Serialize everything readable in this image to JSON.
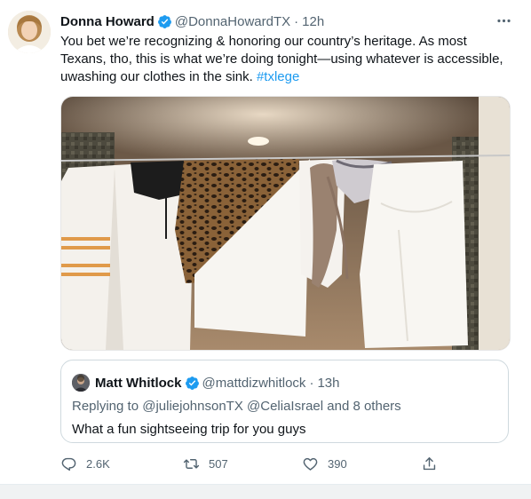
{
  "tweet": {
    "author_name": "Donna Howard",
    "author_handle": "@DonnaHowardTX",
    "separator": "·",
    "time": "12h",
    "text": "You bet we’re recognizing & honoring our country’s heritage. As most Texans, tho, this is what we’re doing tonight—using whatever is accessible, uwashing our clothes in the sink.",
    "hashtag": "#txlege",
    "icons": {
      "avatar": "avatar-photo",
      "verified": "verified-badge-icon",
      "more": "more-options-icon"
    }
  },
  "quoted_tweet": {
    "author_name": "Matt Whitlock",
    "author_handle": "@mattdizwhitlock",
    "separator": "·",
    "time": "13h",
    "replying_to_prefix": "Replying to",
    "replying_to_mentions": "@juliejohnsonTX @CeliaIsrael and 8 others",
    "text": "What a fun sightseeing trip for you guys"
  },
  "actions": {
    "reply_count": "2.6K",
    "retweet_count": "507",
    "like_count": "390",
    "icons": [
      "reply-icon",
      "retweet-icon",
      "like-icon",
      "share-icon"
    ]
  },
  "colors": {
    "accent": "#1d9bf0",
    "secondary_text": "#536471",
    "primary_text": "#0f1419",
    "border": "#cfd9de"
  }
}
